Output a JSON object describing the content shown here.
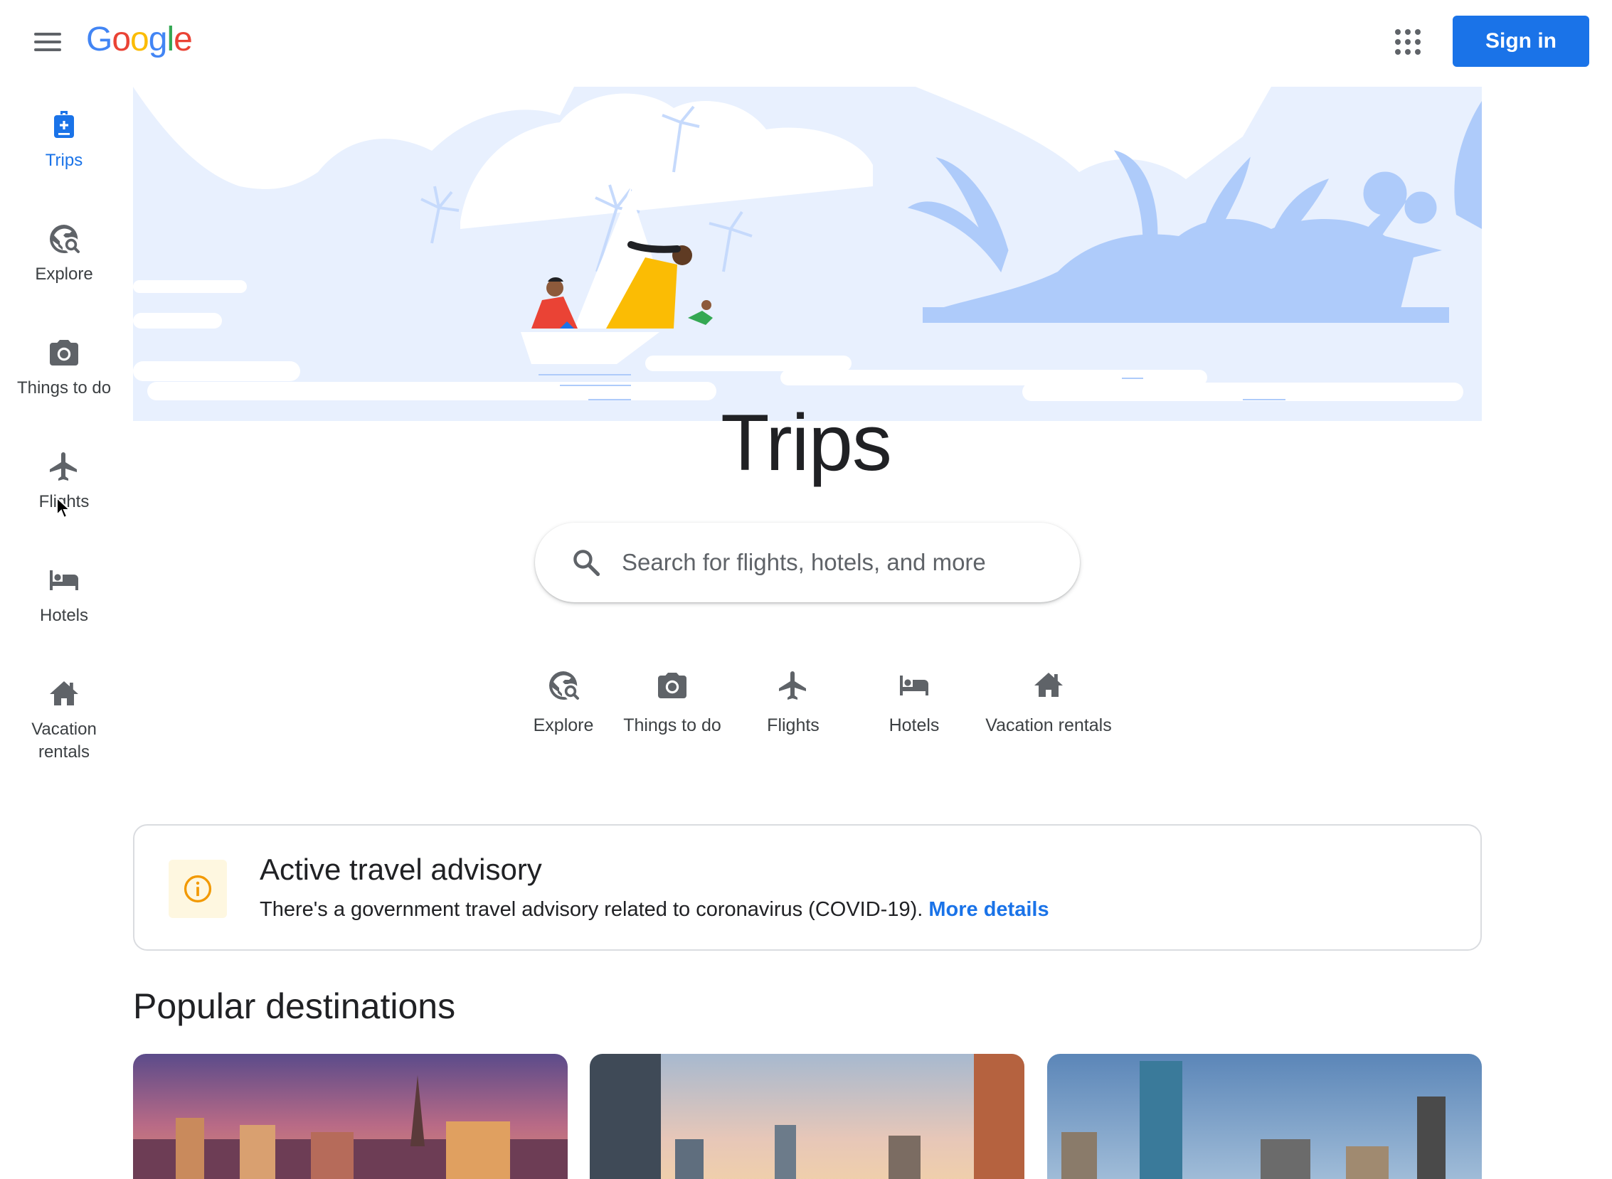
{
  "header": {
    "menu_icon": "hamburger-menu-icon",
    "logo_letters": [
      "G",
      "o",
      "o",
      "g",
      "l",
      "e"
    ],
    "apps_icon": "apps-grid-icon",
    "signin_label": "Sign in"
  },
  "sidebar": {
    "items": [
      {
        "label": "Trips",
        "icon": "trips-luggage-icon",
        "active": true
      },
      {
        "label": "Explore",
        "icon": "explore-globe-icon"
      },
      {
        "label": "Things to do",
        "icon": "camera-icon"
      },
      {
        "label": "Flights",
        "icon": "airplane-icon"
      },
      {
        "label": "Hotels",
        "icon": "bed-icon"
      },
      {
        "label": "Vacation rentals",
        "label_line1": "Vacation",
        "label_line2": "rentals",
        "icon": "house-icon"
      }
    ]
  },
  "hero": {
    "title": "Trips"
  },
  "search": {
    "placeholder": "Search for flights, hotels, and more"
  },
  "quick_links": [
    {
      "label": "Explore",
      "icon": "explore-globe-icon"
    },
    {
      "label": "Things to do",
      "icon": "camera-icon"
    },
    {
      "label": "Flights",
      "icon": "airplane-icon"
    },
    {
      "label": "Hotels",
      "icon": "bed-icon"
    },
    {
      "label": "Vacation rentals",
      "icon": "house-icon"
    }
  ],
  "advisory": {
    "icon": "info-icon",
    "title": "Active travel advisory",
    "text": "There's a government travel advisory related to coronavirus (COVID-19).",
    "link": "More details"
  },
  "popular": {
    "title": "Popular destinations",
    "cards": [
      {
        "image": "las-vegas-skyline-photo"
      },
      {
        "image": "city-skyline-sunset-photo"
      },
      {
        "image": "boston-skyline-photo"
      }
    ]
  },
  "colors": {
    "accent": "#1a73e8",
    "hero_sky": "#e8f0fe",
    "hero_shape": "#aecbfa",
    "advisory_icon_bg": "#fef7e0",
    "advisory_icon": "#f29900"
  }
}
